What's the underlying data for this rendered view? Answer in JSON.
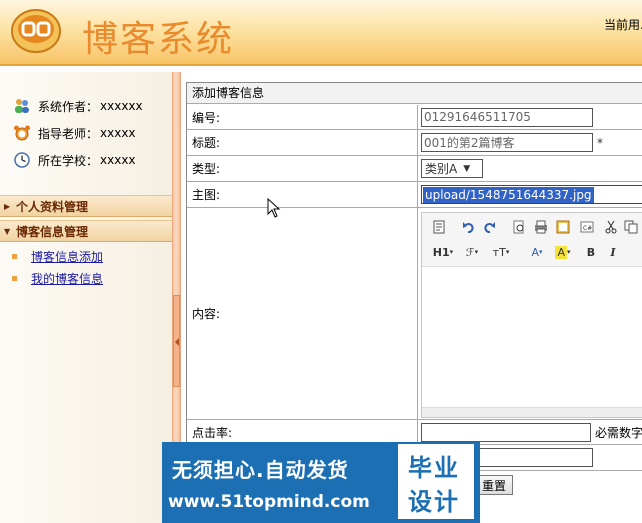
{
  "header": {
    "title": "博客系统",
    "current_user": "当前用..."
  },
  "sidebar": {
    "info": [
      {
        "label": "系统作者：",
        "value": "xxxxxx",
        "icon": "people-icon"
      },
      {
        "label": "指导老师：",
        "value": "xxxxx",
        "icon": "alarm-icon"
      },
      {
        "label": "所在学校：",
        "value": "xxxxx",
        "icon": "clock-icon"
      }
    ],
    "menus": [
      {
        "label": "个人资料管理"
      },
      {
        "label": "博客信息管理"
      }
    ],
    "sub_items": [
      "博客信息添加",
      "我的博客信息"
    ]
  },
  "form": {
    "title": "添加博客信息",
    "fields": {
      "number_label": "编号:",
      "number_value": "01291646511705",
      "title_label": "标题:",
      "title_value": "001的第2篇博客",
      "title_required": "*",
      "type_label": "类型:",
      "type_value": "类别A",
      "image_label": "主图:",
      "image_value": "upload/1548751644337.jpg",
      "content_label": "内容:",
      "clicks_label": "点击率:",
      "clicks_value": "",
      "clicks_note": "必需数字"
    },
    "reset_label": "重置"
  },
  "editor": {
    "toolbar_tools": [
      "source",
      "undo",
      "redo",
      "preview",
      "print",
      "template",
      "code",
      "cut",
      "copy",
      "heading",
      "font-family",
      "font-size",
      "font-color",
      "highlight",
      "bold",
      "italic"
    ],
    "heading_label": "H1",
    "font_family_label": "ℱ",
    "font_size_label": "тT",
    "font_color_label": "A",
    "highlight_label": "A",
    "bold_label": "B",
    "italic_label": "I"
  },
  "watermark": {
    "line1": "无须担心.自动发货",
    "line2": "www.51topmind.com",
    "box_line1": "毕业",
    "box_line2": "设计"
  }
}
